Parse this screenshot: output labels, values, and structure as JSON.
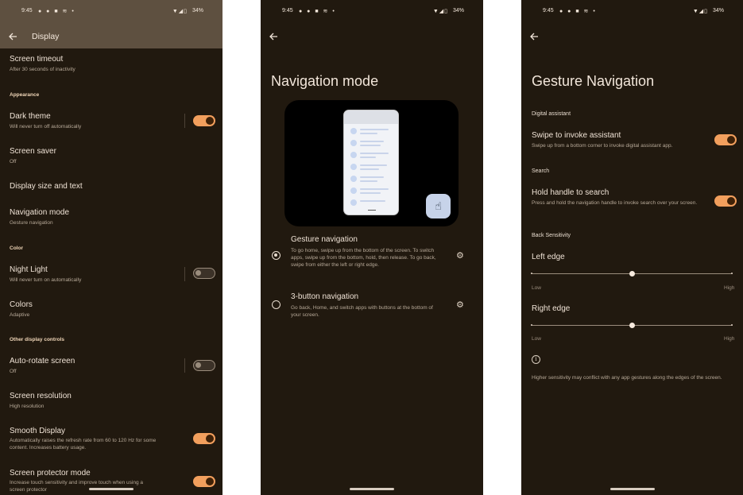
{
  "status_bar": {
    "time": "9:45",
    "left_icons": "● ● ■ ≋ •",
    "right_icons": "▼◢▯",
    "battery": "34%"
  },
  "display": {
    "title": "Display",
    "rows": [
      {
        "title": "Screen timeout",
        "subtitle": "After 30 seconds of inactivity"
      },
      {
        "section": "Appearance"
      },
      {
        "title": "Dark theme",
        "subtitle": "Will never turn off automatically",
        "toggle": true
      },
      {
        "title": "Screen saver",
        "subtitle": "Off"
      },
      {
        "title": "Display size and text"
      },
      {
        "title": "Navigation mode",
        "subtitle": "Gesture navigation"
      },
      {
        "section": "Color"
      },
      {
        "title": "Night Light",
        "subtitle": "Will never turn on automatically",
        "toggle": false
      },
      {
        "title": "Colors",
        "subtitle": "Adaptive"
      },
      {
        "section": "Other display controls"
      },
      {
        "title": "Auto-rotate screen",
        "subtitle": "Off",
        "toggle": false
      },
      {
        "title": "Screen resolution",
        "subtitle": "High resolution"
      },
      {
        "title": "Smooth Display",
        "subtitle": "Automatically raises the refresh rate from 60 to 120 Hz for some",
        "subtitle2": "content. Increases battery usage.",
        "toggle": true
      },
      {
        "title": "Screen protector mode",
        "subtitle": "Increase touch sensitivity and improve touch when using a",
        "subtitle2": "screen protector",
        "toggle": true
      }
    ]
  },
  "nav_mode": {
    "title": "Navigation mode",
    "options": [
      {
        "title": "Gesture navigation",
        "desc": "To go home, swipe up from the bottom of the screen. To switch apps, swipe up from the bottom, hold, then release. To go back, swipe from either the left or right edge.",
        "selected": true
      },
      {
        "title": "3-button navigation",
        "desc": "Go back, Home, and switch apps with buttons at the bottom of your screen.",
        "selected": false
      }
    ]
  },
  "gesture_nav": {
    "title": "Gesture Navigation",
    "digital_assistant_section": "Digital assistant",
    "swipe_title": "Swipe to invoke assistant",
    "swipe_desc": "Swipe up from a bottom corner to invoke digital assistant app.",
    "swipe_on": true,
    "search_section": "Search",
    "hold_title": "Hold handle to search",
    "hold_desc": "Press and hold the navigation handle to invoke search over your screen.",
    "hold_on": true,
    "back_section": "Back Sensitivity",
    "left_edge": "Left edge",
    "right_edge": "Right edge",
    "low": "Low",
    "high": "High",
    "left_level": 0.5,
    "right_level": 0.5,
    "info_text": "Higher sensitivity may conflict with any app gestures along the edges of the screen."
  },
  "colors": {
    "accent": "#f29f5d",
    "background": "#21190f",
    "appbar": "#5e5040"
  }
}
